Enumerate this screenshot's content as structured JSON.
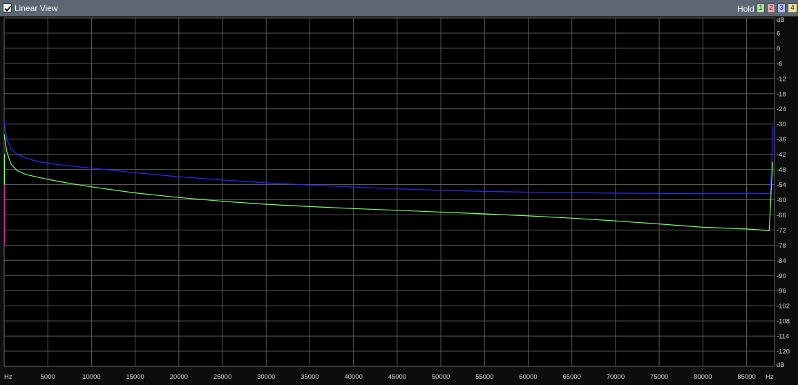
{
  "titlebar": {
    "view_label": "Linear View",
    "view_checked": true,
    "hold_label": "Hold",
    "channel_buttons": [
      "1",
      "2",
      "3",
      "4"
    ]
  },
  "colors": {
    "background": "#000000",
    "grid": "#5a5a5a",
    "titlebar": "#5d6673",
    "series_blue": "#2c2cff",
    "series_green": "#7cff6a",
    "marker_magenta": "#d020a0"
  },
  "chart_data": {
    "type": "line",
    "xlabel": "Hz",
    "ylabel": "dB",
    "xlim": [
      0,
      88200
    ],
    "ylim": [
      -126,
      12
    ],
    "x_ticks": [
      5000,
      10000,
      15000,
      20000,
      25000,
      30000,
      35000,
      40000,
      45000,
      50000,
      55000,
      60000,
      65000,
      70000,
      75000,
      80000,
      85000
    ],
    "x_tick_labels": [
      "5000",
      "10000",
      "15000",
      "20000",
      "25000",
      "30000",
      "35000",
      "40000",
      "45000",
      "50000",
      "55000",
      "60000",
      "65000",
      "70000",
      "75000",
      "80000",
      "85000"
    ],
    "y_ticks": [
      6,
      0,
      -6,
      -12,
      -18,
      -24,
      -30,
      -36,
      -42,
      -48,
      -54,
      -60,
      -66,
      -72,
      -78,
      -84,
      -90,
      -96,
      -102,
      -108,
      -114,
      -120
    ],
    "y_tick_labels": [
      "6",
      "0",
      "-6",
      "-12",
      "-18",
      "-24",
      "-30",
      "-36",
      "-42",
      "-48",
      "-54",
      "-60",
      "-66",
      "-72",
      "-78",
      "-84",
      "-90",
      "-96",
      "-102",
      "-108",
      "-114",
      "-120"
    ],
    "x_axis_left_label": "Hz",
    "x_axis_right_label": "Hz",
    "y_axis_top_label": "dB",
    "y_axis_bottom_label": "dB",
    "grid": true,
    "series": [
      {
        "color": "#2c2cff",
        "x": [
          0,
          300,
          800,
          1500,
          2500,
          4000,
          6000,
          8000,
          10000,
          15000,
          20000,
          25000,
          30000,
          35000,
          40000,
          45000,
          50000,
          55000,
          60000,
          65000,
          70000,
          75000,
          80000,
          85000,
          87700,
          87900,
          88000
        ],
        "y": [
          -29,
          -36,
          -40,
          -42,
          -43.5,
          -45,
          -46,
          -46.8,
          -47.5,
          -49.3,
          -50.9,
          -52.2,
          -53.3,
          -54.2,
          -55,
          -55.7,
          -56.3,
          -56.7,
          -57,
          -57.2,
          -57.4,
          -57.5,
          -57.6,
          -57.6,
          -57.6,
          -44,
          -31
        ]
      },
      {
        "color": "#7cff6a",
        "x": [
          0,
          300,
          800,
          1500,
          2500,
          4000,
          6000,
          8000,
          10000,
          15000,
          20000,
          25000,
          30000,
          35000,
          40000,
          45000,
          50000,
          55000,
          60000,
          65000,
          70000,
          75000,
          80000,
          85000,
          87600,
          87800,
          88000
        ],
        "y": [
          -34,
          -41,
          -46,
          -48.5,
          -50,
          -51.2,
          -52.6,
          -53.8,
          -54.9,
          -57.3,
          -59.1,
          -60.6,
          -61.8,
          -62.7,
          -63.5,
          -64.2,
          -64.9,
          -65.6,
          -66.4,
          -67.3,
          -68.4,
          -69.6,
          -70.9,
          -71.6,
          -72.2,
          -58,
          -45
        ]
      }
    ],
    "markers": [
      {
        "color": "#d020a0",
        "x": 0,
        "y_from": -54,
        "y_to": -78
      },
      {
        "color": "#7cff6a",
        "x": 0,
        "y_from": -42,
        "y_to": -54
      }
    ]
  }
}
